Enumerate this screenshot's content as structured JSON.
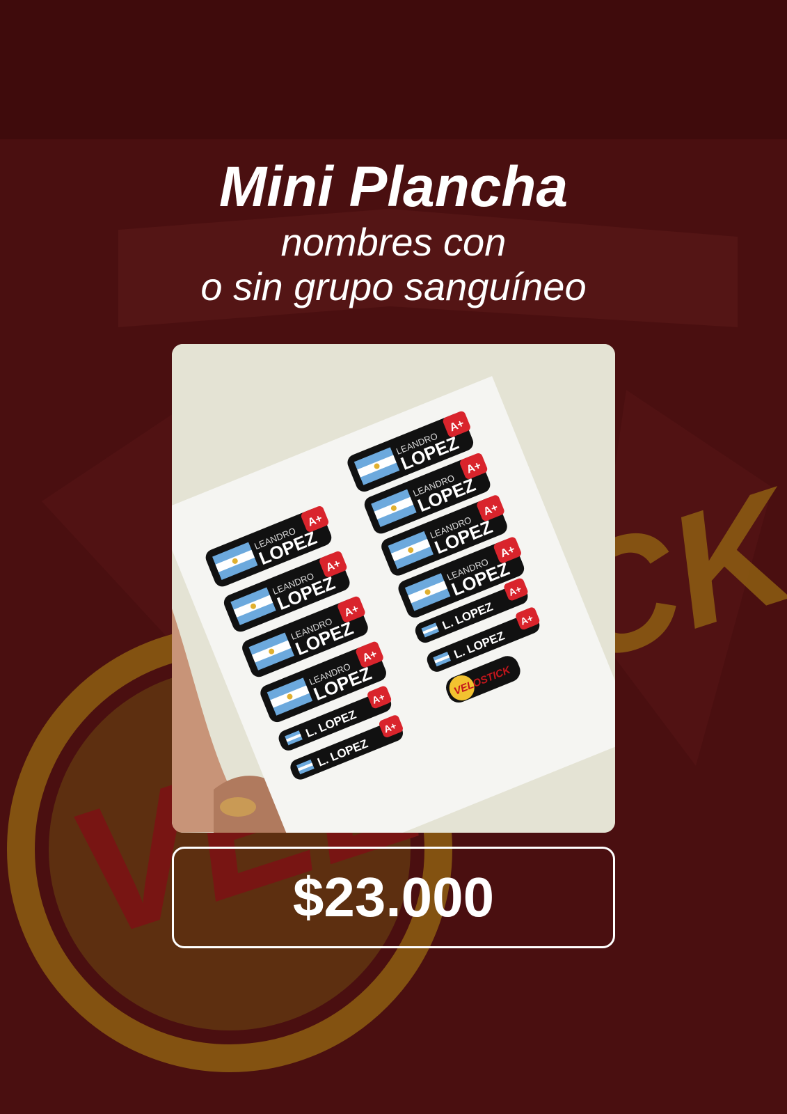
{
  "title": "Mini Plancha",
  "subtitle": [
    "nombres con",
    "o sin grupo sanguíneo"
  ],
  "price": "$23.000",
  "product_image": {
    "label": "LEANDRO",
    "surname": "LOPEZ",
    "short_name": "L. LOPEZ",
    "blood_type": "A+",
    "brand_sticker": "VELOSTICK"
  },
  "background_brand": "VELOSTICK",
  "colors": {
    "background": "#4a0f10",
    "brand_yellow": "#8a5a12",
    "brand_red": "#7a1414",
    "text": "#ffffff"
  }
}
